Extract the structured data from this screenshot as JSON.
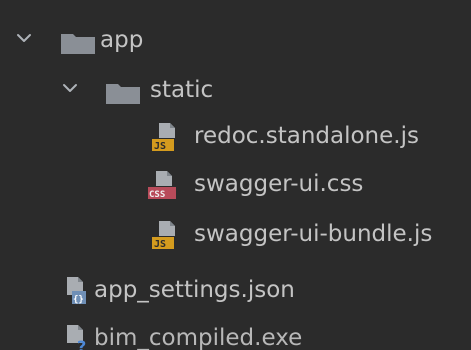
{
  "tree": {
    "items": [
      {
        "label": "app",
        "icon": "folder-icon",
        "expanded": true
      },
      {
        "label": "static",
        "icon": "folder-icon",
        "expanded": true
      },
      {
        "label": "redoc.standalone.js",
        "icon": "javascript-file-icon",
        "badge": "JS"
      },
      {
        "label": "swagger-ui.css",
        "icon": "css-file-icon",
        "badge": "CSS"
      },
      {
        "label": "swagger-ui-bundle.js",
        "icon": "javascript-file-icon",
        "badge": "JS"
      },
      {
        "label": "app_settings.json",
        "icon": "json-file-icon",
        "badge": "{}"
      },
      {
        "label": "bim_compiled.exe",
        "icon": "executable-file-icon",
        "badge": "?"
      }
    ]
  },
  "colors": {
    "background": "#2b2b2b",
    "text": "#c4c4c4",
    "folder": "#8a8f96",
    "js_badge": "#d49b1e",
    "css_badge": "#b84b5a",
    "json_badge": "#6f8fb6",
    "exe_badge": "#4d88d6"
  }
}
